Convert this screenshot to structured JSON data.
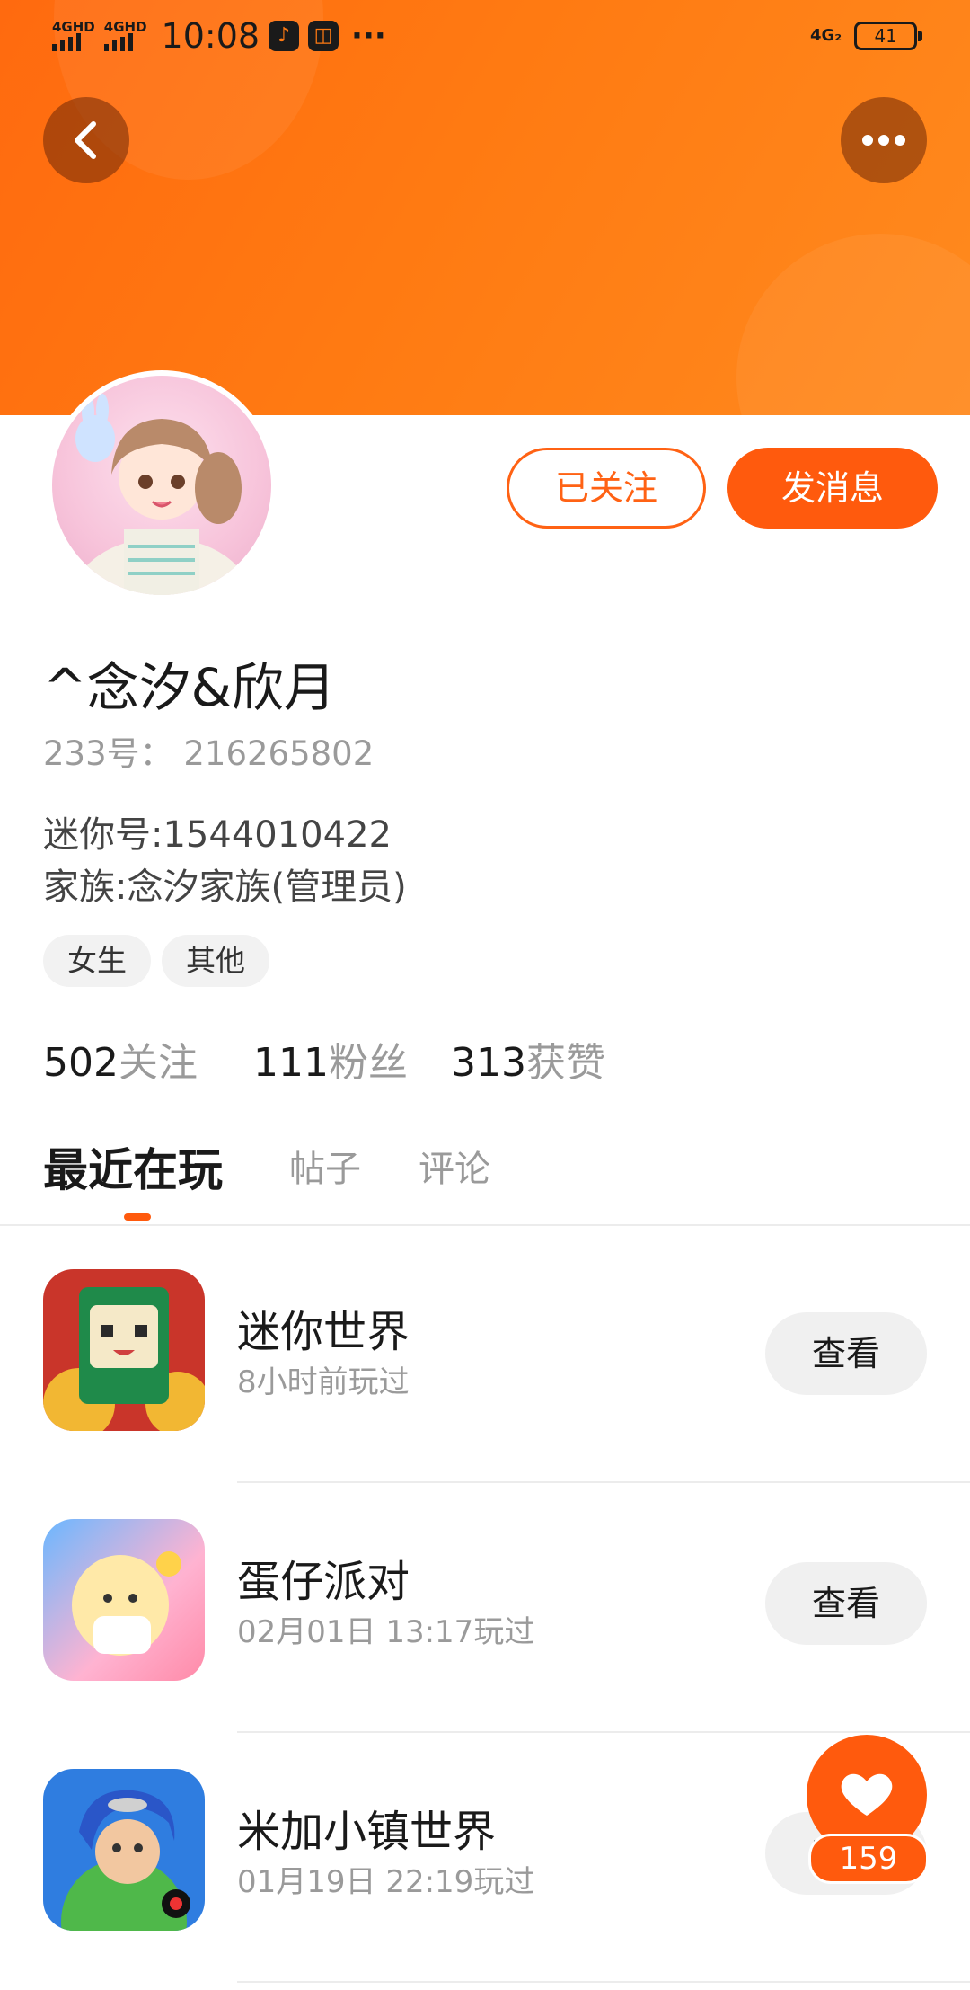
{
  "status_bar": {
    "signal1": "4GHD",
    "signal2": "4GHD",
    "time": "10:08",
    "more": "···",
    "network": "4G₂",
    "battery": "41"
  },
  "profile": {
    "name": "^念汐&欣月",
    "id_233": "233号：  216265802",
    "mini_id": "迷你号:1544010422",
    "family": "家族:念汐家族(管理员)",
    "tags": [
      "女生",
      "其他"
    ],
    "follow_button": "已关注",
    "message_button": "发消息"
  },
  "stats": [
    {
      "num": "502",
      "label": "关注"
    },
    {
      "num": "111",
      "label": "粉丝"
    },
    {
      "num": "313",
      "label": "获赞"
    }
  ],
  "tabs": [
    {
      "label": "最近在玩",
      "active": true
    },
    {
      "label": "帖子",
      "active": false
    },
    {
      "label": "评论",
      "active": false
    }
  ],
  "games": [
    {
      "title": "迷你世界",
      "subtitle": "8小时前玩过",
      "button": "查看"
    },
    {
      "title": "蛋仔派对",
      "subtitle": "02月01日 13:17玩过",
      "button": "查看"
    },
    {
      "title": "米加小镇世界",
      "subtitle": "01月19日 22:19玩过",
      "button": "查看"
    }
  ],
  "like_fab": {
    "count": "159"
  },
  "colors": {
    "accent": "#ff5a0d",
    "banner": "#ff7a12",
    "muted": "#9a9a9a"
  }
}
